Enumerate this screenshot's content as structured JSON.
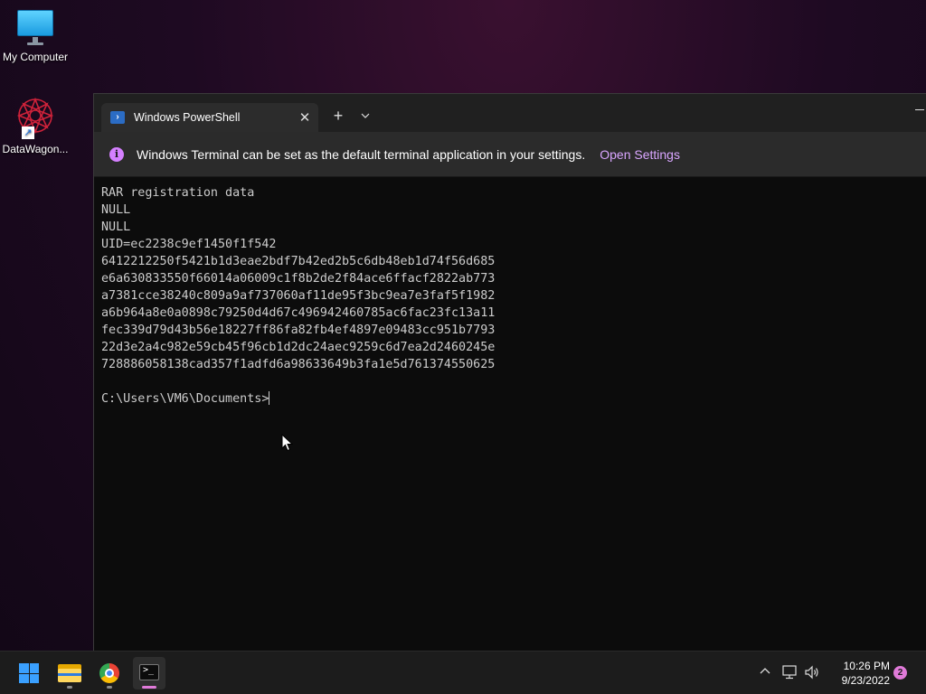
{
  "desktop": {
    "icons": [
      {
        "label": "My Computer"
      },
      {
        "label": "DataWagon..."
      }
    ]
  },
  "terminal": {
    "tab_title": "Windows PowerShell",
    "infobar": {
      "message": "Windows Terminal can be set as the default terminal application in your settings.",
      "link": "Open Settings"
    },
    "output_lines": [
      "RAR registration data",
      "NULL",
      "NULL",
      "UID=ec2238c9ef1450f1f542",
      "6412212250f5421b1d3eae2bdf7b42ed2b5c6db48eb1d74f56d685",
      "e6a630833550f66014a06009c1f8b2de2f84ace6ffacf2822ab773",
      "a7381cce38240c809a9af737060af11de95f3bc9ea7e3faf5f1982",
      "a6b964a8e0a0898c79250d4d67c496942460785ac6fac23fc13a11",
      "fec339d79d43b56e18227ff86fa82fb4ef4897e09483cc951b7793",
      "22d3e2a4c982e59cb45f96cb1d2dc24aec9259c6d7ea2d2460245e",
      "728886058138cad357f1adfd6a98633649b3fa1e5d761374550625",
      ""
    ],
    "prompt": "C:\\Users\\VM6\\Documents>"
  },
  "taskbar": {
    "apps": [
      "start",
      "file-explorer",
      "chrome",
      "windows-terminal"
    ],
    "clock": {
      "time": "10:26 PM",
      "date": "9/23/2022"
    },
    "notification_count": "2"
  },
  "colors": {
    "accent_purple": "#e07ad9",
    "info_icon": "#d580ff",
    "link": "#d9a6ff"
  }
}
